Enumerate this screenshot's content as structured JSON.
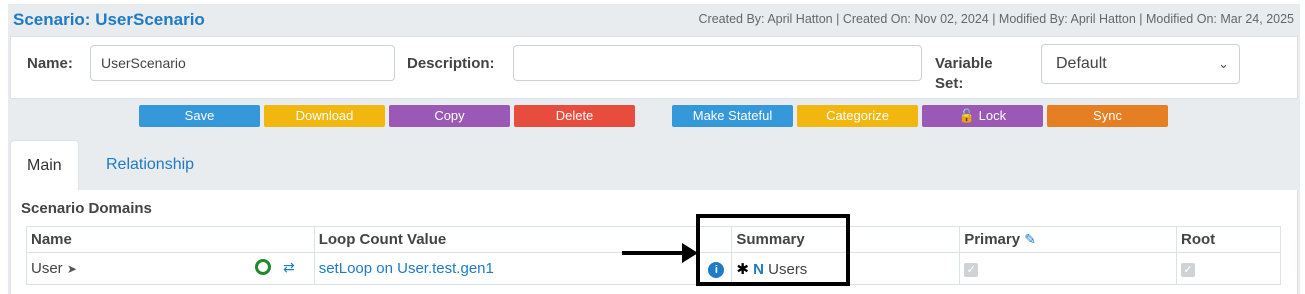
{
  "header": {
    "title_prefix": "Scenario: ",
    "title_name": "UserScenario",
    "meta": "Created By: April Hatton | Created On: Nov 02, 2024 | Modified By: April Hatton | Modified On: Mar 24, 2025"
  },
  "form": {
    "name_label": "Name:",
    "name_value": "UserScenario",
    "description_label": "Description:",
    "description_value": "",
    "variable_label_line1": "Variable",
    "variable_label_line2": "Set:",
    "variable_value": "Default"
  },
  "toolbar": {
    "save": "Save",
    "download": "Download",
    "copy": "Copy",
    "delete": "Delete",
    "make_stateful": "Make Stateful",
    "categorize": "Categorize",
    "lock": "Lock",
    "sync": "Sync"
  },
  "tabs": [
    {
      "label": "Main",
      "active": true
    },
    {
      "label": "Relationship",
      "active": false
    }
  ],
  "section": {
    "title": "Scenario Domains",
    "columns": [
      "Name",
      "Loop Count Value",
      "Summary",
      "Primary",
      "Root"
    ],
    "rows": [
      {
        "name": "User",
        "loop_count": "setLoop on User.test.gen1",
        "summary_prefix": "N",
        "summary_text": "Users",
        "primary_checked": true,
        "root_checked": true
      }
    ]
  },
  "colors": {
    "accent": "#1e7bc4",
    "blue": "#3498db",
    "yellow": "#f1b70e",
    "purple": "#9b59b6",
    "red": "#e74c3c",
    "orange": "#e67e22",
    "green": "#1e8a2e"
  }
}
